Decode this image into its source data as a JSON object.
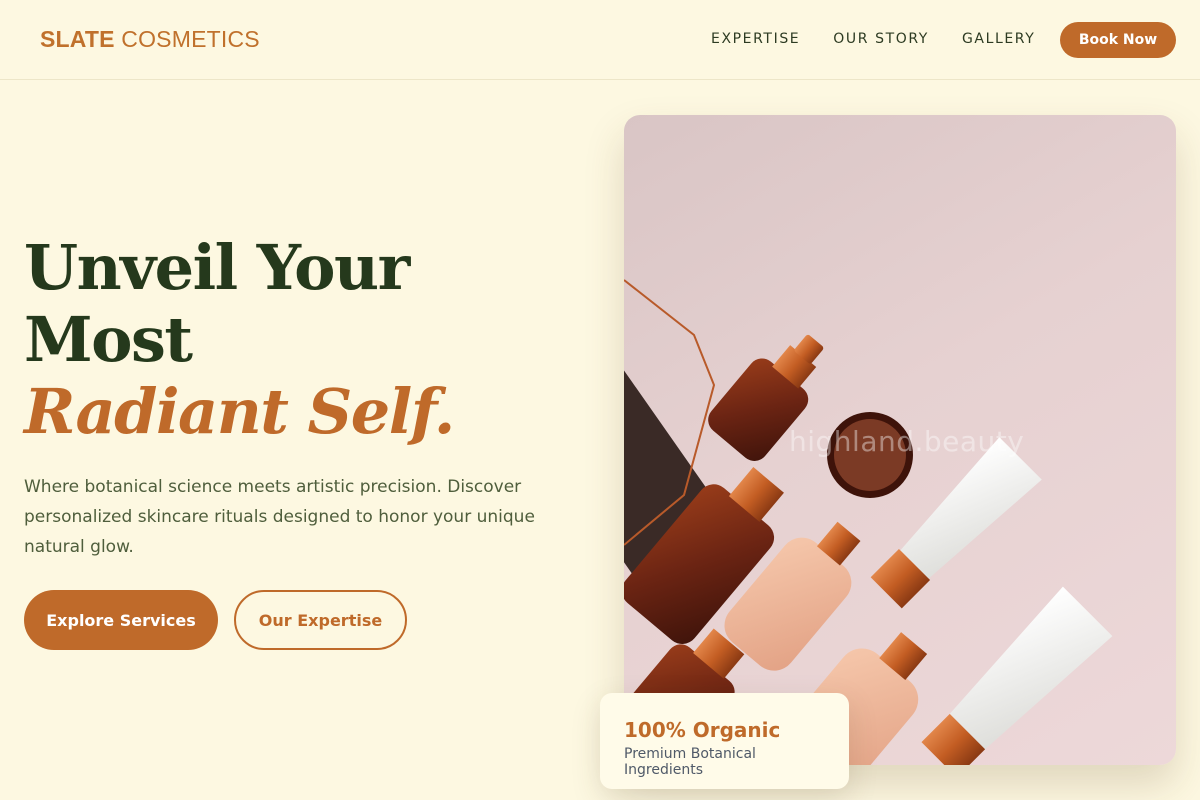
{
  "brand": {
    "name_bold": "SLATE",
    "name_light": "COSMETICS"
  },
  "nav": {
    "items": [
      "EXPERTISE",
      "OUR STORY",
      "GALLERY"
    ],
    "cta": "Book Now"
  },
  "hero": {
    "headline_line1": "Unveil Your",
    "headline_line2": "Most",
    "headline_accent": "Radiant Self.",
    "subtext": "Where botanical science meets artistic precision. Discover personalized skincare rituals designed to honor your unique natural glow.",
    "primary_button": "Explore Services",
    "secondary_button": "Our Expertise"
  },
  "image": {
    "watermark": "highland.beauty"
  },
  "badge": {
    "title": "100% Organic",
    "subtitle": "Premium Botanical Ingredients"
  },
  "colors": {
    "background": "#fdf8e1",
    "accent": "#bf6a2a",
    "heading": "#25391c"
  }
}
